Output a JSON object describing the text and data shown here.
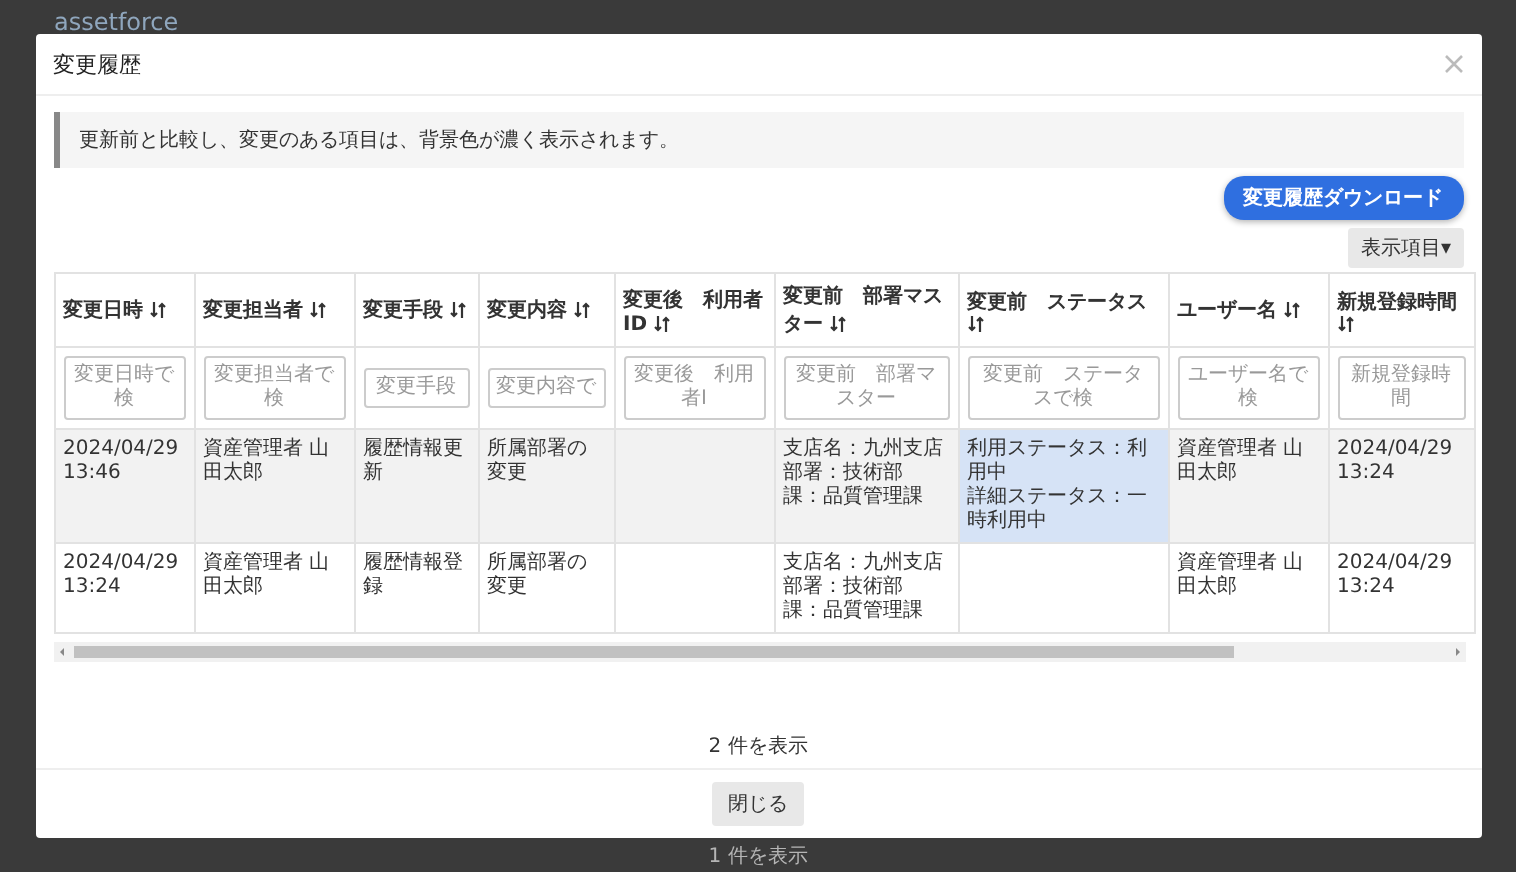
{
  "background_app": {
    "logo": "assetforce",
    "record_count": "1 件を表示"
  },
  "dialog": {
    "title": "変更履歴",
    "notice": "更新前と比較し、変更のある項目は、背景色が濃く表示されます。",
    "download_button": "変更履歴ダウンロード",
    "columns_button": "表示項目▾",
    "table": {
      "columns": [
        {
          "label": "変更日時",
          "placeholder": "変更日時で検"
        },
        {
          "label": "変更担当者",
          "placeholder": "変更担当者で検"
        },
        {
          "label": "変更手段",
          "placeholder": "変更手段"
        },
        {
          "label": "変更内容",
          "placeholder": "変更内容で"
        },
        {
          "label": "変更後　利用者ID",
          "placeholder": "変更後　利用者I"
        },
        {
          "label": "変更前　部署マスター",
          "placeholder": "変更前　部署マスター"
        },
        {
          "label": "変更前　ステータス",
          "placeholder": "変更前　ステータスで検"
        },
        {
          "label": "ユーザー名",
          "placeholder": "ユーザー名で検"
        },
        {
          "label": "新規登録時間",
          "placeholder": "新規登録時間"
        }
      ],
      "rows": [
        {
          "shaded": true,
          "cells": [
            {
              "lines": [
                "2024/04/29 13:46"
              ],
              "changed": false
            },
            {
              "lines": [
                "資産管理者 山田太郎"
              ],
              "changed": false
            },
            {
              "lines": [
                "履歴情報更新"
              ],
              "changed": false
            },
            {
              "lines": [
                "所属部署の変更"
              ],
              "changed": false
            },
            {
              "changed": false
            },
            {
              "lines": [
                "支店名：九州支店",
                "部署：技術部",
                "課：品質管理課"
              ],
              "changed": false
            },
            {
              "lines": [
                "利用ステータス：利用中",
                "詳細ステータス：一時利用中"
              ],
              "changed": true
            },
            {
              "lines": [
                "資産管理者 山田太郎"
              ],
              "changed": false
            },
            {
              "lines": [
                "2024/04/29 13:24"
              ],
              "changed": false
            }
          ]
        },
        {
          "shaded": false,
          "cells": [
            {
              "lines": [
                "2024/04/29 13:24"
              ],
              "changed": false
            },
            {
              "lines": [
                "資産管理者 山田太郎"
              ],
              "changed": false
            },
            {
              "lines": [
                "履歴情報登録"
              ],
              "changed": false
            },
            {
              "lines": [
                "所属部署の変更"
              ],
              "changed": false
            },
            {
              "changed": false
            },
            {
              "lines": [
                "支店名：九州支店",
                "部署：技術部",
                "課：品質管理課"
              ],
              "changed": false
            },
            {
              "changed": false
            },
            {
              "lines": [
                "資産管理者 山田太郎"
              ],
              "changed": false
            },
            {
              "lines": [
                "2024/04/29 13:24"
              ],
              "changed": false
            }
          ]
        }
      ]
    },
    "record_count": "2 件を表示",
    "close_button": "閉じる"
  }
}
